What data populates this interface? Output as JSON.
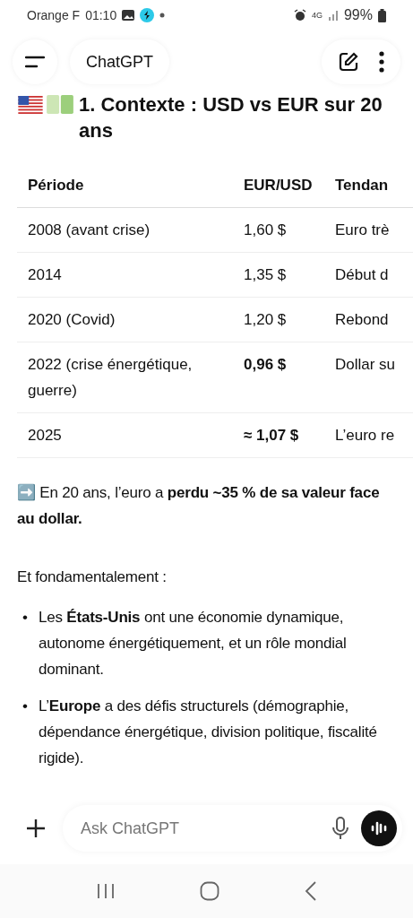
{
  "status_bar": {
    "carrier": "Orange F",
    "time": "01:10",
    "network": "4G",
    "battery": "99%"
  },
  "header": {
    "title": "ChatGPT"
  },
  "heading": "1. Contexte : USD vs EUR sur 20 ans",
  "table": {
    "columns": [
      "Période",
      "EUR/USD",
      "Tendan"
    ],
    "rows": [
      {
        "cells": [
          "2008 (avant crise)",
          "1,60 $",
          "Euro trè"
        ],
        "rate_bold": false
      },
      {
        "cells": [
          "2014",
          "1,35 $",
          "Début d"
        ],
        "rate_bold": false
      },
      {
        "cells": [
          "2020 (Covid)",
          "1,20 $",
          "Rebond"
        ],
        "rate_bold": false
      },
      {
        "cells": [
          "2022 (crise énergétique, guerre)",
          "0,96 $",
          "Dollar su"
        ],
        "rate_bold": true
      },
      {
        "cells": [
          "2025",
          "≈ 1,07 $",
          "L’euro re"
        ],
        "rate_bold": true
      }
    ]
  },
  "summary": "➡️ En 20 ans, l’euro a **perdu ~35 % de sa valeur face au dollar.**",
  "intro": "Et fondamentalement :",
  "bullets": [
    {
      "marker": "•",
      "text": "Les **États-Unis** ont une économie dynamique, autonome énergétiquement, et un rôle mondial dominant."
    },
    {
      "marker": "•",
      "text": "L’**Europe** a des défis structurels (démographie, dépendance énergétique, division politique, fiscalité rigide)."
    }
  ],
  "composer": {
    "placeholder": "Ask ChatGPT"
  }
}
